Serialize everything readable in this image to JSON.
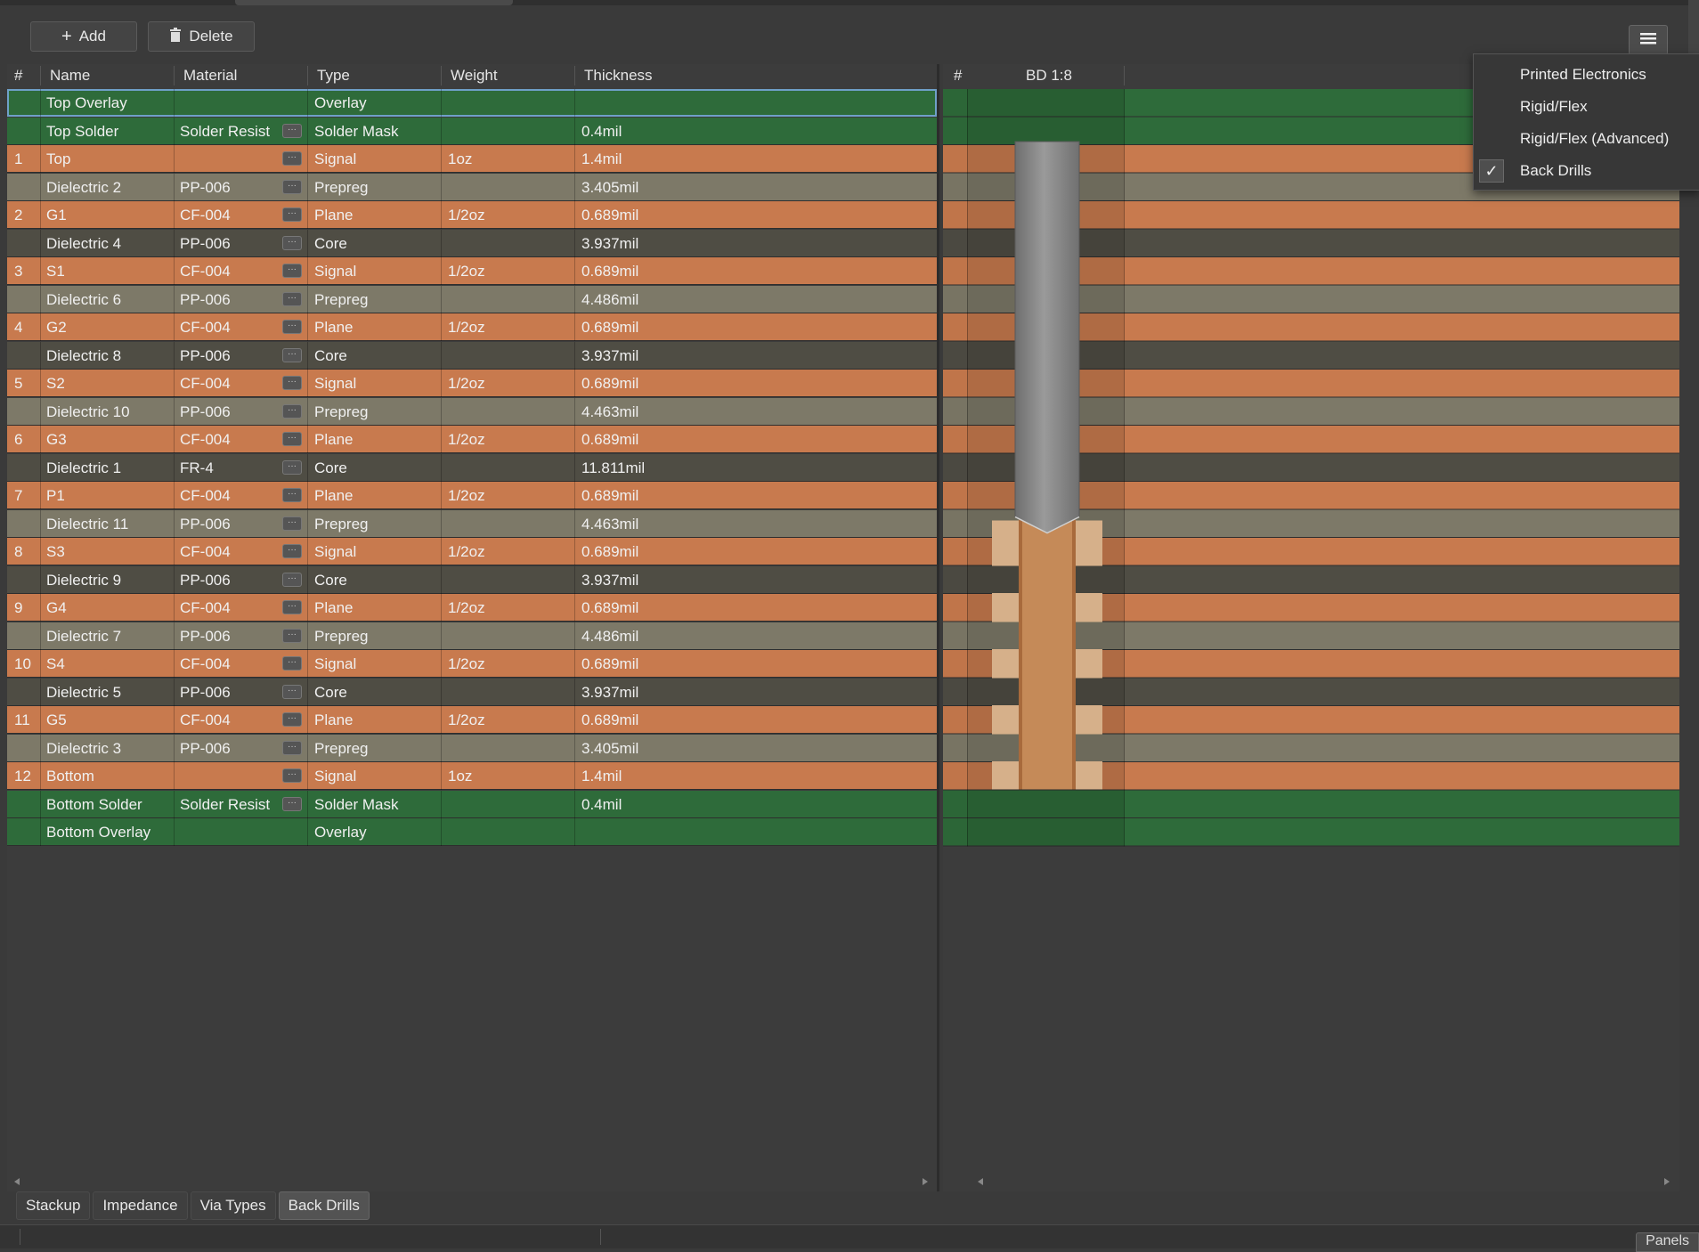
{
  "toolbar": {
    "add_label": "Add",
    "delete_label": "Delete"
  },
  "table": {
    "columns": {
      "num": "#",
      "name": "Name",
      "material": "Material",
      "type": "Type",
      "weight": "Weight",
      "thickness": "Thickness"
    },
    "rows": [
      {
        "num": "",
        "name": "Top Overlay",
        "material": "",
        "type": "Overlay",
        "weight": "",
        "thickness": "",
        "kind": "overlay",
        "btn": false
      },
      {
        "num": "",
        "name": "Top Solder",
        "material": "Solder Resist",
        "type": "Solder Mask",
        "weight": "",
        "thickness": "0.4mil",
        "kind": "mask",
        "btn": true
      },
      {
        "num": "1",
        "name": "Top",
        "material": "",
        "type": "Signal",
        "weight": "1oz",
        "thickness": "1.4mil",
        "kind": "copper",
        "btn": true
      },
      {
        "num": "",
        "name": "Dielectric 2",
        "material": "PP-006",
        "type": "Prepreg",
        "weight": "",
        "thickness": "3.405mil",
        "kind": "prepreg",
        "btn": true
      },
      {
        "num": "2",
        "name": "G1",
        "material": "CF-004",
        "type": "Plane",
        "weight": "1/2oz",
        "thickness": "0.689mil",
        "kind": "copper",
        "btn": true
      },
      {
        "num": "",
        "name": "Dielectric 4",
        "material": "PP-006",
        "type": "Core",
        "weight": "",
        "thickness": "3.937mil",
        "kind": "core",
        "btn": true
      },
      {
        "num": "3",
        "name": "S1",
        "material": "CF-004",
        "type": "Signal",
        "weight": "1/2oz",
        "thickness": "0.689mil",
        "kind": "copper",
        "btn": true
      },
      {
        "num": "",
        "name": "Dielectric 6",
        "material": "PP-006",
        "type": "Prepreg",
        "weight": "",
        "thickness": "4.486mil",
        "kind": "prepreg",
        "btn": true
      },
      {
        "num": "4",
        "name": "G2",
        "material": "CF-004",
        "type": "Plane",
        "weight": "1/2oz",
        "thickness": "0.689mil",
        "kind": "copper",
        "btn": true
      },
      {
        "num": "",
        "name": "Dielectric 8",
        "material": "PP-006",
        "type": "Core",
        "weight": "",
        "thickness": "3.937mil",
        "kind": "core",
        "btn": true
      },
      {
        "num": "5",
        "name": "S2",
        "material": "CF-004",
        "type": "Signal",
        "weight": "1/2oz",
        "thickness": "0.689mil",
        "kind": "copper",
        "btn": true
      },
      {
        "num": "",
        "name": "Dielectric 10",
        "material": "PP-006",
        "type": "Prepreg",
        "weight": "",
        "thickness": "4.463mil",
        "kind": "prepreg",
        "btn": true
      },
      {
        "num": "6",
        "name": "G3",
        "material": "CF-004",
        "type": "Plane",
        "weight": "1/2oz",
        "thickness": "0.689mil",
        "kind": "copper",
        "btn": true
      },
      {
        "num": "",
        "name": "Dielectric 1",
        "material": "FR-4",
        "type": "Core",
        "weight": "",
        "thickness": "11.811mil",
        "kind": "core",
        "btn": true
      },
      {
        "num": "7",
        "name": "P1",
        "material": "CF-004",
        "type": "Plane",
        "weight": "1/2oz",
        "thickness": "0.689mil",
        "kind": "copper",
        "btn": true
      },
      {
        "num": "",
        "name": "Dielectric 11",
        "material": "PP-006",
        "type": "Prepreg",
        "weight": "",
        "thickness": "4.463mil",
        "kind": "prepreg",
        "btn": true
      },
      {
        "num": "8",
        "name": "S3",
        "material": "CF-004",
        "type": "Signal",
        "weight": "1/2oz",
        "thickness": "0.689mil",
        "kind": "copper",
        "btn": true
      },
      {
        "num": "",
        "name": "Dielectric 9",
        "material": "PP-006",
        "type": "Core",
        "weight": "",
        "thickness": "3.937mil",
        "kind": "core",
        "btn": true
      },
      {
        "num": "9",
        "name": "G4",
        "material": "CF-004",
        "type": "Plane",
        "weight": "1/2oz",
        "thickness": "0.689mil",
        "kind": "copper",
        "btn": true
      },
      {
        "num": "",
        "name": "Dielectric 7",
        "material": "PP-006",
        "type": "Prepreg",
        "weight": "",
        "thickness": "4.486mil",
        "kind": "prepreg",
        "btn": true
      },
      {
        "num": "10",
        "name": "S4",
        "material": "CF-004",
        "type": "Signal",
        "weight": "1/2oz",
        "thickness": "0.689mil",
        "kind": "copper",
        "btn": true
      },
      {
        "num": "",
        "name": "Dielectric 5",
        "material": "PP-006",
        "type": "Core",
        "weight": "",
        "thickness": "3.937mil",
        "kind": "core",
        "btn": true
      },
      {
        "num": "11",
        "name": "G5",
        "material": "CF-004",
        "type": "Plane",
        "weight": "1/2oz",
        "thickness": "0.689mil",
        "kind": "copper",
        "btn": true
      },
      {
        "num": "",
        "name": "Dielectric 3",
        "material": "PP-006",
        "type": "Prepreg",
        "weight": "",
        "thickness": "3.405mil",
        "kind": "prepreg",
        "btn": true
      },
      {
        "num": "12",
        "name": "Bottom",
        "material": "",
        "type": "Signal",
        "weight": "1oz",
        "thickness": "1.4mil",
        "kind": "copper",
        "btn": true
      },
      {
        "num": "",
        "name": "Bottom Solder",
        "material": "Solder Resist",
        "type": "Solder Mask",
        "weight": "",
        "thickness": "0.4mil",
        "kind": "mask",
        "btn": true
      },
      {
        "num": "",
        "name": "Bottom Overlay",
        "material": "",
        "type": "Overlay",
        "weight": "",
        "thickness": "",
        "kind": "overlay",
        "btn": false
      }
    ]
  },
  "drill_view": {
    "num_header": "#",
    "bd_header": "BD 1:8"
  },
  "colors": {
    "overlay": "#2e6b3a",
    "mask": "#2e6b3a",
    "copper": "#c87a4e",
    "prepreg": "#7d7968",
    "core": "#4f4d44"
  },
  "bottom_tabs": [
    "Stackup",
    "Impedance",
    "Via Types",
    "Back Drills"
  ],
  "active_tab": "Back Drills",
  "menu": {
    "items": [
      {
        "label": "Printed Electronics",
        "checked": false
      },
      {
        "label": "Rigid/Flex",
        "checked": false
      },
      {
        "label": "Rigid/Flex (Advanced)",
        "checked": false
      },
      {
        "label": "Back Drills",
        "checked": true
      }
    ]
  },
  "statusbar": {
    "panels_label": "Panels"
  }
}
